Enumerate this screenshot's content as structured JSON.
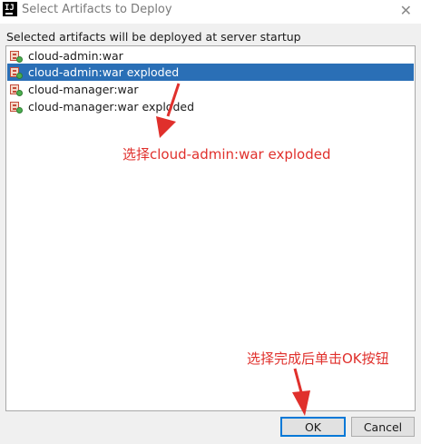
{
  "window": {
    "title": "Select Artifacts to Deploy",
    "app_icon": "IJ"
  },
  "subtitle": "Selected artifacts will be deployed at server startup",
  "artifacts": [
    {
      "label": "cloud-admin:war",
      "selected": false
    },
    {
      "label": "cloud-admin:war exploded",
      "selected": true
    },
    {
      "label": "cloud-manager:war",
      "selected": false
    },
    {
      "label": "cloud-manager:war exploded",
      "selected": false
    }
  ],
  "annotations": {
    "select_hint": "选择cloud-admin:war exploded",
    "ok_hint": "选择完成后单击OK按钮"
  },
  "buttons": {
    "ok": "OK",
    "cancel": "Cancel"
  },
  "colors": {
    "selection": "#2a6fb6",
    "annotation": "#e0302c"
  },
  "icons": {
    "close": "close-icon",
    "artifact": "war-artifact-icon"
  }
}
